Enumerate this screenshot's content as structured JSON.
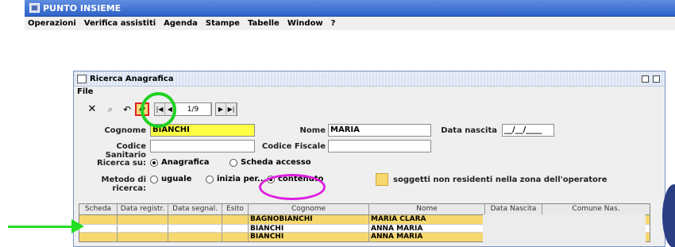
{
  "app": {
    "title": "PUNTO INSIEME"
  },
  "menu": [
    "Operazioni",
    "Verifica assistiti",
    "Agenda",
    "Stampe",
    "Tabelle",
    "Window",
    "?"
  ],
  "window": {
    "title": "Ricerca Anagrafica",
    "menu": "File"
  },
  "toolbar": {
    "record_counter": "1/9"
  },
  "form": {
    "cognome_label": "Cognome",
    "cognome_value": "BIANCHI",
    "nome_label": "Nome",
    "nome_value": "MARIA",
    "data_nascita_label": "Data nascita",
    "data_nascita_value": "__/__/____",
    "codice_sanitario_label": "Codice Sanitario",
    "codice_sanitario_value": "",
    "codice_fiscale_label": "Codice Fiscale",
    "codice_fiscale_value": "",
    "ricerca_su_label": "Ricerca su:",
    "ricerca_su_options": [
      "Anagrafica",
      "Scheda accesso"
    ],
    "metodo_label": "Metodo di ricerca:",
    "metodo_options": [
      "uguale",
      "inizia per...",
      "contenuto"
    ],
    "legend_text": "soggetti non residenti nella zona dell'operatore"
  },
  "table": {
    "columns": [
      "Scheda",
      "Data registr.",
      "Data segnal.",
      "Esito",
      "Cognome",
      "Nome",
      "Data Nascita",
      "Comune Nas."
    ],
    "rows": [
      {
        "cognome": "BAGNOBIANCHI",
        "nome": "MARIA CLARA",
        "highlight": true
      },
      {
        "cognome": "BIANCHI",
        "nome": "ANNA MARIA",
        "highlight": false
      },
      {
        "cognome": "BIANCHI",
        "nome": "ANNA MARIA",
        "highlight": true
      }
    ]
  },
  "colors": {
    "accent_yellow": "#ffff44",
    "row_yellow": "#f7d86f",
    "annotation_green": "#22d024",
    "annotation_magenta": "#e01fe0"
  }
}
